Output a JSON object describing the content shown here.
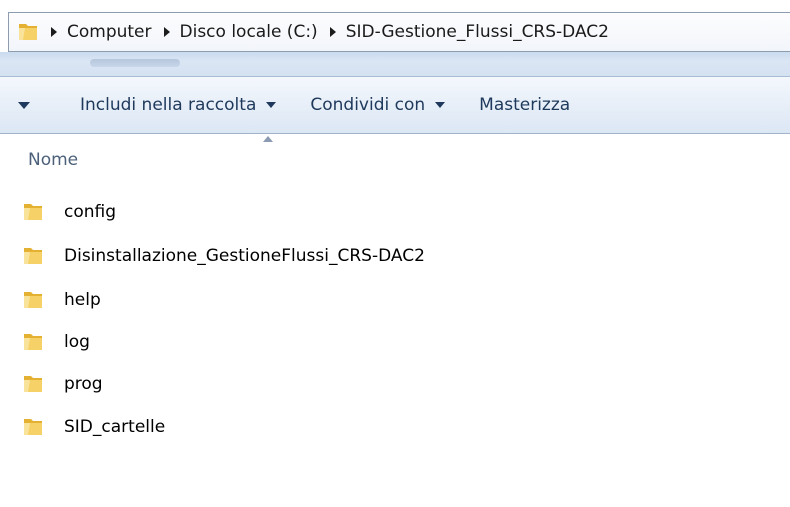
{
  "address_bar": {
    "folder_icon": "folder-icon",
    "breadcrumbs": [
      {
        "label": "Computer"
      },
      {
        "label": "Disco locale (C:)"
      },
      {
        "label": "SID-Gestione_Flussi_CRS-DAC2"
      }
    ]
  },
  "command_bar": {
    "items": [
      {
        "label": "Includi nella raccolta",
        "has_dropdown": true
      },
      {
        "label": "Condividi con",
        "has_dropdown": true
      },
      {
        "label": "Masterizza",
        "has_dropdown": false
      }
    ]
  },
  "column_header": {
    "name_label": "Nome",
    "sort": "ascending"
  },
  "files": [
    {
      "name": "config",
      "icon": "folder-icon"
    },
    {
      "name": "Disinstallazione_GestioneFlussi_CRS-DAC2",
      "icon": "folder-icon"
    },
    {
      "name": "help",
      "icon": "folder-icon"
    },
    {
      "name": "log",
      "icon": "folder-icon"
    },
    {
      "name": "prog",
      "icon": "folder-icon"
    },
    {
      "name": "SID_cartelle",
      "icon": "folder-icon"
    }
  ],
  "colors": {
    "folder_yellow": "#f4c84a",
    "folder_dark": "#c9951c",
    "command_text": "#1e395b"
  }
}
